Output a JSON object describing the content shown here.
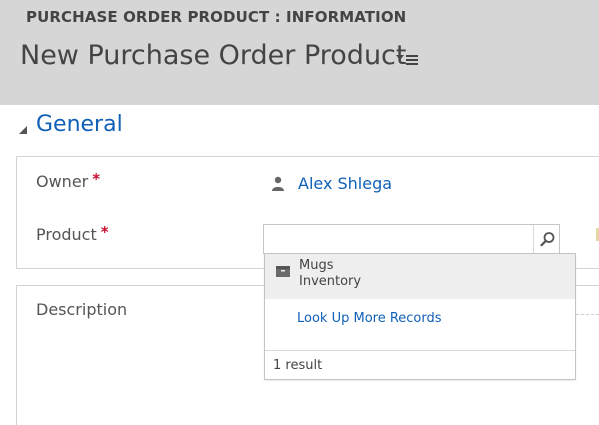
{
  "header": {
    "entity_label": "PURCHASE ORDER PRODUCT : INFORMATION",
    "record_title": "New Purchase Order Product",
    "background": "#d6d6d6"
  },
  "section": {
    "title": "General",
    "accent": "#1160b7"
  },
  "fields": {
    "owner": {
      "label": "Owner",
      "required_marker": "*",
      "value": "Alex Shlega",
      "icon": "person-icon"
    },
    "product": {
      "label": "Product",
      "required_marker": "*",
      "value": "",
      "search_icon": "magnifier-icon"
    },
    "description": {
      "label": "Description"
    }
  },
  "lookup_dropdown": {
    "results": [
      {
        "name": "Mugs",
        "subtitle": "Inventory",
        "icon": "product-box-icon"
      }
    ],
    "look_up_more": "Look Up More Records",
    "result_count": "1 result"
  },
  "colors": {
    "link": "#1160b7",
    "required": "#c8102e",
    "highlight": "#eeeeee"
  }
}
